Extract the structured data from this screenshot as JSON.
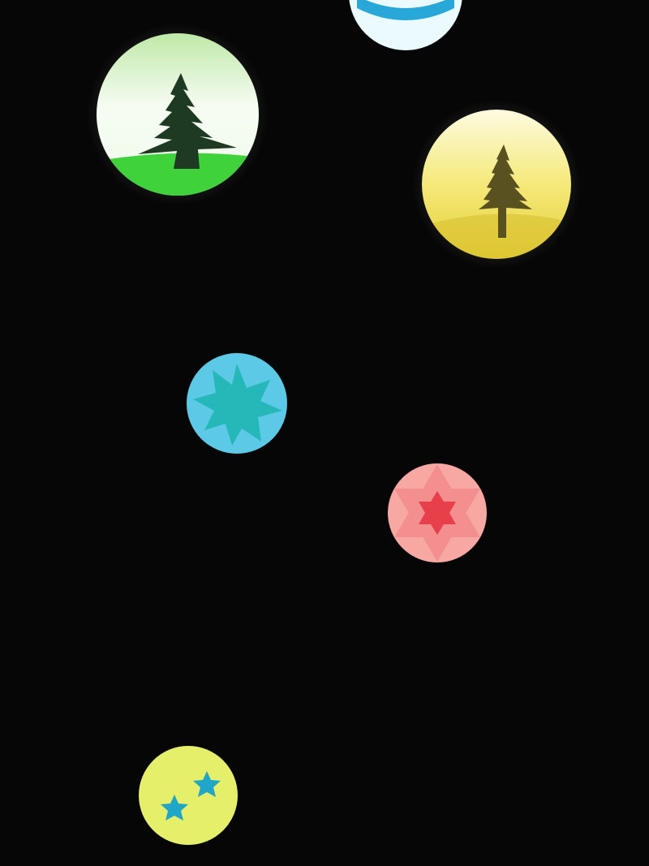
{
  "colors": {
    "background": "#060606",
    "green_disc_sky": "#f4fbf0",
    "green_disc_hill": "#3fd23a",
    "tree_dark": "#1f3a22",
    "yellow_disc_light": "#fbf6c0",
    "yellow_disc_dark": "#e6d43a",
    "tree_olive": "#5a5120",
    "blue_disc": "#5cc9e6",
    "blue_star": "#26b8b8",
    "pink_disc": "#f7a8a2",
    "red_star": "#e8404a",
    "lime_disc": "#e6ef6a",
    "teal_star": "#1fa6c8",
    "top_disc": "#eafaff",
    "top_disc_accent": "#27a8d8"
  }
}
